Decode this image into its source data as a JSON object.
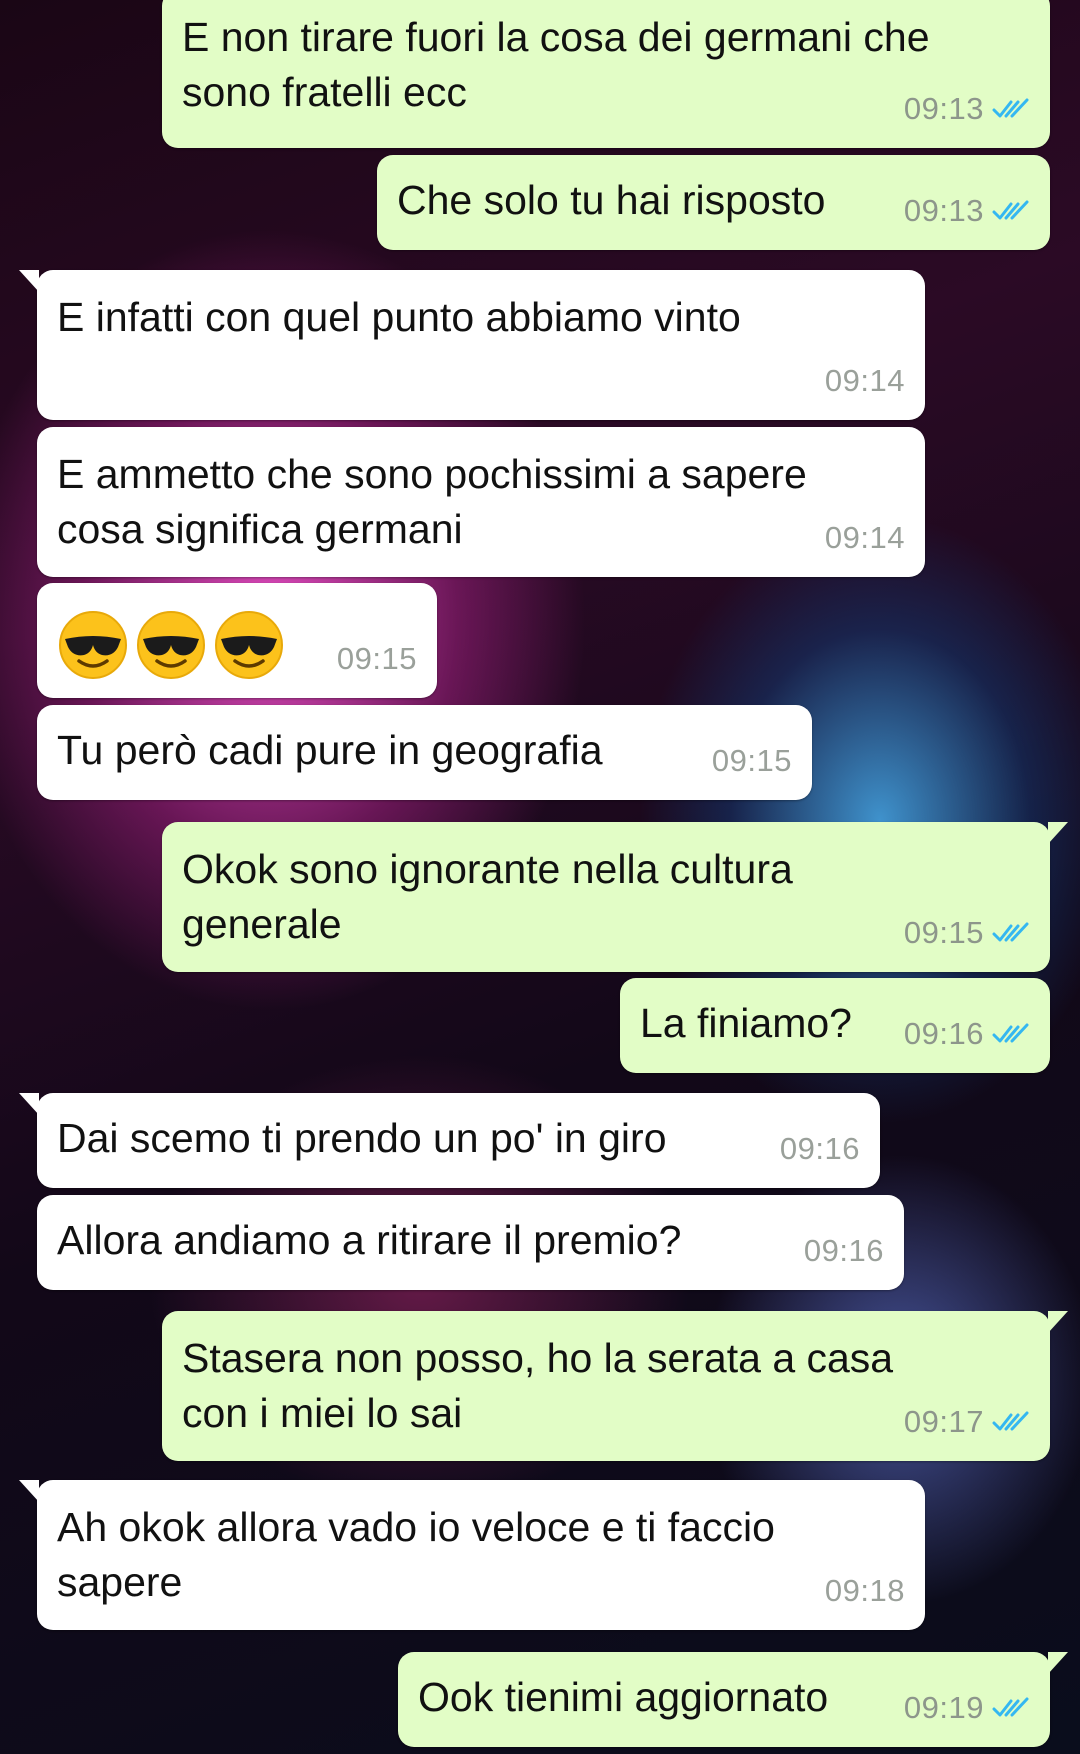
{
  "colors": {
    "outgoing_bubble": "#e2fdc6",
    "incoming_bubble": "#ffffff",
    "read_ticks": "#34b7f1",
    "timestamp": "#8d968b"
  },
  "messages": [
    {
      "direction": "out",
      "text": "E non tirare fuori la cosa dei germani che\nsono fratelli ecc",
      "time": "09:13",
      "status": "read"
    },
    {
      "direction": "out",
      "text": "Che solo tu hai risposto",
      "time": "09:13",
      "status": "read"
    },
    {
      "direction": "in",
      "text": "E infatti con quel punto abbiamo vinto",
      "time": "09:14"
    },
    {
      "direction": "in",
      "text": "E ammetto che sono pochissimi a sapere\ncosa significa germani",
      "time": "09:14"
    },
    {
      "direction": "in",
      "emoji": [
        "smiling-face-with-sunglasses",
        "smiling-face-with-sunglasses",
        "smiling-face-with-sunglasses"
      ],
      "time": "09:15"
    },
    {
      "direction": "in",
      "text": "Tu però cadi pure in geografia",
      "time": "09:15"
    },
    {
      "direction": "out",
      "text": "Okok sono ignorante nella cultura\ngenerale",
      "time": "09:15",
      "status": "read"
    },
    {
      "direction": "out",
      "text": "La finiamo?",
      "time": "09:16",
      "status": "read"
    },
    {
      "direction": "in",
      "text": "Dai scemo ti prendo un po' in giro",
      "time": "09:16"
    },
    {
      "direction": "in",
      "text": "Allora andiamo a ritirare il premio?",
      "time": "09:16"
    },
    {
      "direction": "out",
      "text": "Stasera non posso, ho la serata a casa\ncon i miei lo sai",
      "time": "09:17",
      "status": "read"
    },
    {
      "direction": "in",
      "text": "Ah okok allora vado io veloce e ti faccio\nsapere",
      "time": "09:18"
    },
    {
      "direction": "out",
      "text": "Ook tienimi aggiornato",
      "time": "09:19",
      "status": "read"
    }
  ]
}
